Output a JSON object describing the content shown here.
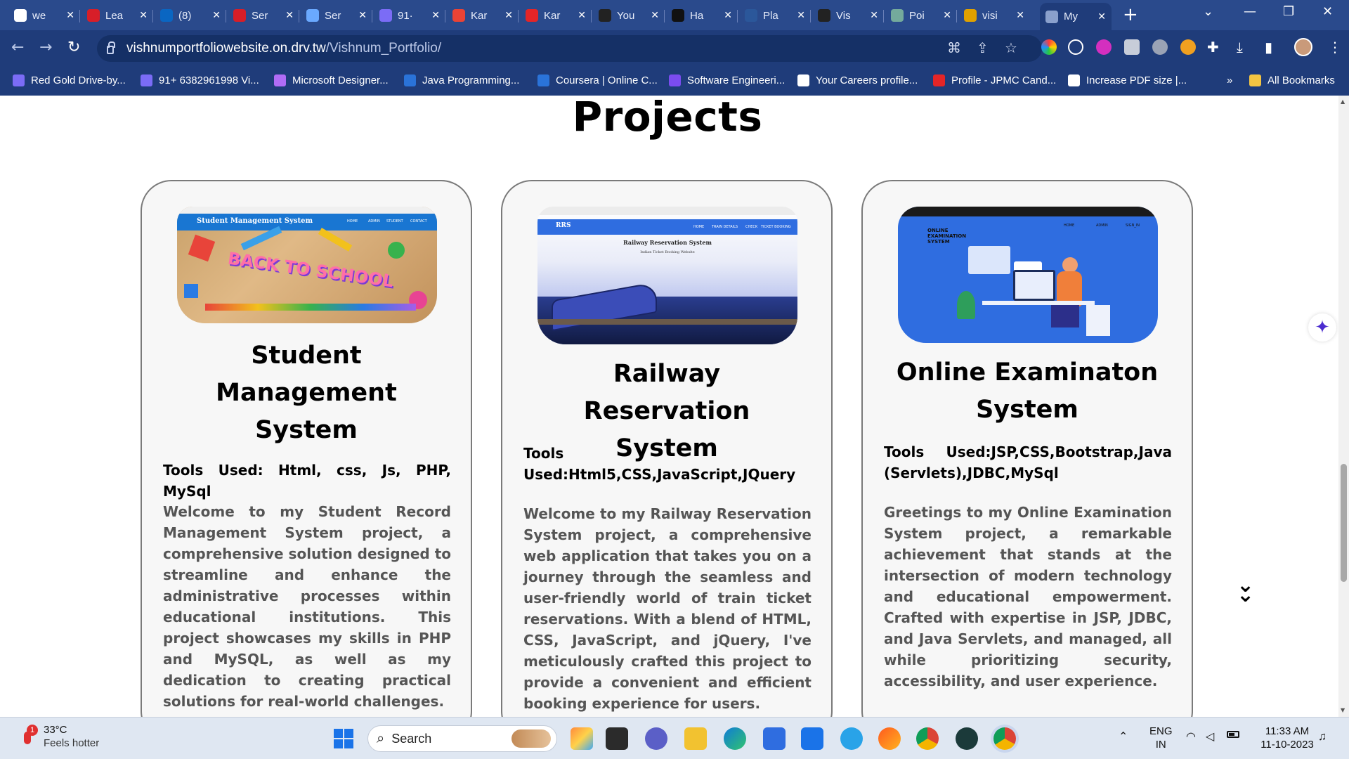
{
  "browser": {
    "tabs": [
      {
        "title": "we",
        "icon": "google-icon",
        "color": "#ffffff"
      },
      {
        "title": "Lea",
        "icon": "wf-icon",
        "color": "#d71e28"
      },
      {
        "title": "(8)",
        "icon": "linkedin-icon",
        "color": "#0a66c2"
      },
      {
        "title": "Ser",
        "icon": "wf-icon",
        "color": "#d71e28"
      },
      {
        "title": "Ser",
        "icon": "service-icon",
        "color": "#6aa9ff"
      },
      {
        "title": "91·",
        "icon": "chat-icon",
        "color": "#7b6cf6"
      },
      {
        "title": "Kar",
        "icon": "gmail-icon",
        "color": "#ea4335"
      },
      {
        "title": "Kar",
        "icon": "zoho-icon",
        "color": "#e42527"
      },
      {
        "title": "You",
        "icon": "github-icon",
        "color": "#222222"
      },
      {
        "title": "Ha",
        "icon": "hackerrank-icon",
        "color": "#111111"
      },
      {
        "title": "Pla",
        "icon": "word-icon",
        "color": "#2b579a"
      },
      {
        "title": "Vis",
        "icon": "github-icon",
        "color": "#222222"
      },
      {
        "title": "Poi",
        "icon": "chatgpt-icon",
        "color": "#74aa9c"
      },
      {
        "title": "visi",
        "icon": "drive-icon",
        "color": "#e0a100"
      },
      {
        "title": "My",
        "icon": "globe-icon",
        "color": "#8aa0cc"
      }
    ],
    "new_tab": "+",
    "url_host": "vishnumportfoliowebsite.on.drv.tw",
    "url_path": "/Vishnum_Portfolio/",
    "bookmarks": [
      {
        "label": "Red Gold Drive-by...",
        "color": "#7b6cf6"
      },
      {
        "label": "91+ 6382961998 Vi...",
        "color": "#7b6cf6"
      },
      {
        "label": "Microsoft Designer...",
        "color": "#b06cf6"
      },
      {
        "label": "Java Programming...",
        "color": "#2a73d9"
      },
      {
        "label": "Coursera | Online C...",
        "color": "#2a73d9"
      },
      {
        "label": "Software Engineeri...",
        "color": "#7b4cf0"
      },
      {
        "label": "Your Careers profile...",
        "color": "#ffffff"
      },
      {
        "label": "Profile - JPMC Cand...",
        "color": "#e42527"
      },
      {
        "label": "Increase PDF size |...",
        "color": "#ffffff"
      }
    ],
    "more_bookmarks": "»",
    "all_bookmarks": "All Bookmarks"
  },
  "page": {
    "section_title": "Projects",
    "projects": [
      {
        "title": "Student Management System",
        "tools": "Tools Used: Html, css, Js, PHP, MySql",
        "description": "Welcome to my Student Record Management System project, a comprehensive solution designed to streamline and enhance the administrative processes within educational institutions. This project showcases my skills in PHP and MySQL, as well as my dedication to creating practical solutions for real-world challenges.",
        "screenshot": {
          "header": "Student Management System",
          "nav": [
            "HOME",
            "ADMIN",
            "STUDENT",
            "CONTACT"
          ],
          "banner": "BACK TO SCHOOL"
        }
      },
      {
        "title": "Railway Reservation System",
        "tools": "Tools Used:Html5,CSS,JavaScript,JQuery",
        "description": "Welcome to my Railway Reservation System project, a comprehensive web application that takes you on a journey through the seamless and user-friendly world of train ticket reservations. With a blend of HTML, CSS, JavaScript, and jQuery, I've meticulously crafted this project to provide a convenient and efficient booking experience for users.",
        "screenshot": {
          "logo": "RRS",
          "header": "Railway Reservation System",
          "subheader": "Indian Ticket Booking Website",
          "nav": [
            "HOME",
            "TRAIN DETAILS",
            "CHECK",
            "TICKET BOOKING"
          ]
        }
      },
      {
        "title": "Online Examinaton System",
        "tools": "Tools Used:JSP,CSS,Bootstrap,Java (Servlets),JDBC,MySql",
        "description": "Greetings to my Online Examination System project, a remarkable achievement that stands at the intersection of modern technology and educational empowerment. Crafted with expertise in JSP, JDBC, and Java Servlets, and managed, all while prioritizing security, accessibility, and user experience.",
        "screenshot": {
          "header": "ONLINE EXAMINATION SYSTEM",
          "nav": [
            "HOME",
            "ADMIN",
            "SIGN_IN"
          ]
        }
      }
    ]
  },
  "taskbar": {
    "weather_temp": "33°C",
    "weather_desc": "Feels hotter",
    "weather_badge": "1",
    "search_placeholder": "Search",
    "lang_line1": "ENG",
    "lang_line2": "IN",
    "time": "11:33 AM",
    "date": "11-10-2023"
  }
}
